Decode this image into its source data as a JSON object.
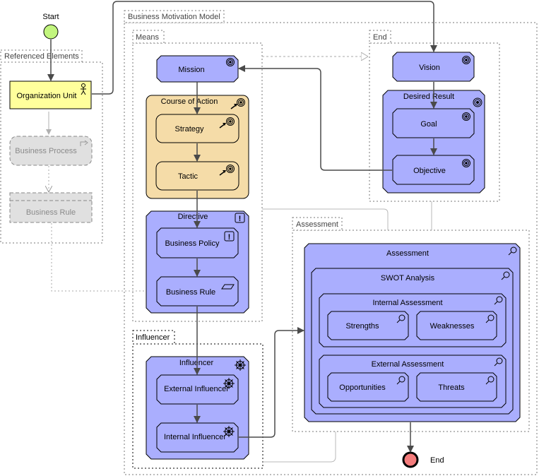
{
  "colors": {
    "blue_fill": "#aaaefe",
    "tan_fill": "#f5dca8",
    "yellow_fill": "#ffff9c",
    "ghost_fill": "#e0e0e0",
    "start_fill": "#c2f57e",
    "end_fill": "#f47c7c",
    "stroke": "#000000",
    "connector": "#4a4a4a",
    "ghost_line": "#b0b0b0"
  },
  "start": {
    "label": "Start"
  },
  "end": {
    "label": "End"
  },
  "groups": {
    "referenced": "Referenced Elements",
    "bmm": "Business Motivation Model",
    "means": "Means",
    "end": "End",
    "influencer": "Influencer",
    "assessment": "Assessment"
  },
  "referenced": {
    "org_unit": {
      "label": "Organization Unit",
      "icon": "actor-icon"
    },
    "business_process": {
      "label": "Business Process",
      "icon": "process-icon"
    },
    "business_rule": {
      "label": "Business Rule"
    }
  },
  "means": {
    "mission": {
      "label": "Mission",
      "icon": "target-icon"
    },
    "course_of_action": {
      "label": "Course of Action",
      "icon": "arrow-target-icon"
    },
    "strategy": {
      "label": "Strategy",
      "icon": "arrow-target-icon"
    },
    "tactic": {
      "label": "Tactic",
      "icon": "arrow-target-icon"
    },
    "directive": {
      "label": "Directive",
      "icon": "exclamation-icon"
    },
    "business_policy": {
      "label": "Business Policy",
      "icon": "exclamation-icon"
    },
    "business_rule": {
      "label": "Business Rule",
      "icon": "parallelogram-icon"
    }
  },
  "ends": {
    "vision": {
      "label": "Vision",
      "icon": "target-icon"
    },
    "desired_result": {
      "label": "Desired Result",
      "icon": "target-icon"
    },
    "goal": {
      "label": "Goal",
      "icon": "target-icon"
    },
    "objective": {
      "label": "Objective",
      "icon": "target-icon"
    }
  },
  "influencers": {
    "influencer": {
      "label": "Influencer",
      "icon": "helm-icon"
    },
    "external": {
      "label": "External Influencer",
      "icon": "helm-icon"
    },
    "internal": {
      "label": "Internal Influencer",
      "icon": "helm-icon"
    }
  },
  "assessment": {
    "assessment": {
      "label": "Assessment",
      "icon": "magnifier-icon"
    },
    "swot": {
      "label": "SWOT Analysis",
      "icon": "magnifier-icon"
    },
    "internal": {
      "label": "Internal Assessment",
      "icon": "magnifier-icon"
    },
    "strengths": {
      "label": "Strengths",
      "icon": "magnifier-icon"
    },
    "weaknesses": {
      "label": "Weaknesses",
      "icon": "magnifier-icon"
    },
    "external": {
      "label": "External Assessment",
      "icon": "magnifier-icon"
    },
    "opportunities": {
      "label": "Opportunities",
      "icon": "magnifier-icon"
    },
    "threats": {
      "label": "Threats",
      "icon": "magnifier-icon"
    }
  }
}
